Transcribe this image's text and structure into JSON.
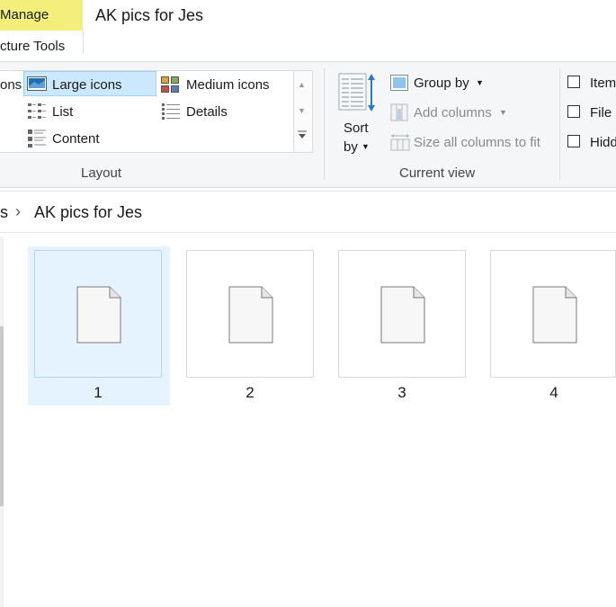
{
  "window": {
    "manage_tab": "Manage",
    "picture_tools": "cture Tools",
    "title": "AK pics for Jes"
  },
  "ribbon": {
    "layout": {
      "items": {
        "extra_large_partial": "ons",
        "large_icons": "Large icons",
        "medium_icons": "Medium icons",
        "list": "List",
        "details": "Details",
        "content": "Content"
      },
      "group_label": "Layout"
    },
    "current_view": {
      "sort_by_line1": "Sort",
      "sort_by_line2": "by",
      "group_by": "Group by",
      "add_columns": "Add columns",
      "size_all_columns": "Size all columns to fit",
      "group_label": "Current view"
    },
    "show_hide": {
      "item_checkboxes": "Item",
      "file_name_extensions": "File",
      "hidden_items": "Hidd"
    }
  },
  "address": {
    "crumb_partial": "s",
    "separator": "›",
    "current": "AK pics for Jes"
  },
  "files": [
    {
      "name": "1",
      "selected": true
    },
    {
      "name": "2",
      "selected": false
    },
    {
      "name": "3",
      "selected": false
    },
    {
      "name": "4",
      "selected": false
    }
  ]
}
